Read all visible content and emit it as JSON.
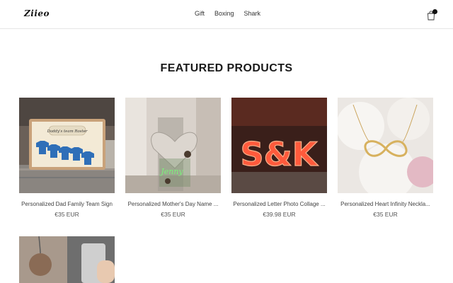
{
  "header": {
    "logo": "Ziieo",
    "nav": [
      "Gift",
      "Boxing",
      "Shark"
    ],
    "cart_icon": "shopping-bag-icon"
  },
  "section": {
    "title": "FEATURED PRODUCTS"
  },
  "products": [
    {
      "title": "Personalized Dad Family Team Sign",
      "price": "€35 EUR"
    },
    {
      "title": "Personalized Mother's Day Name ...",
      "price": "€35 EUR"
    },
    {
      "title": "Personalized Letter Photo Collage ...",
      "price": "€39.98 EUR"
    },
    {
      "title": "Personalized Heart Infinity Neckla...",
      "price": "€35 EUR"
    }
  ],
  "sign_text": "Daddy's team Roster",
  "letters_text": "S&K",
  "lamp_text": "Jenny"
}
